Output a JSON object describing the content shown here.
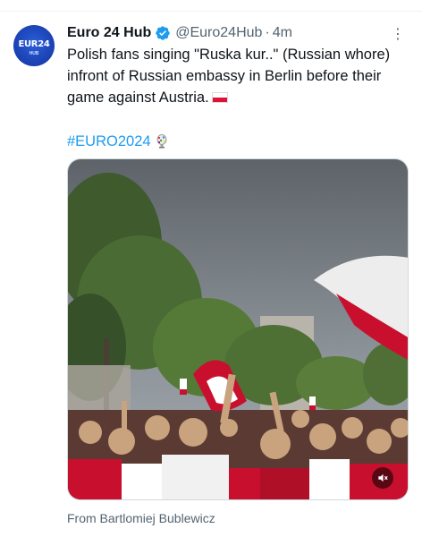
{
  "tweet": {
    "avatar": {
      "text": "EUR24",
      "sub": "HUB"
    },
    "display_name": "Euro 24 Hub",
    "handle": "@Euro24Hub",
    "separator": "·",
    "time": "4m",
    "more_icon": "⋮",
    "text": "Polish fans singing \"Ruska kur..\" (Russian whore) infront of Russian embassy in Berlin before their game against Austria.",
    "hashtag": "#EURO2024",
    "attribution": "From Bartlomiej Bublewicz"
  },
  "media": {
    "type": "video",
    "mute_icon": "speaker-muted-icon"
  },
  "colors": {
    "accent": "#1d9bf0",
    "secondary_text": "#536471",
    "primary_text": "#0f1419"
  }
}
